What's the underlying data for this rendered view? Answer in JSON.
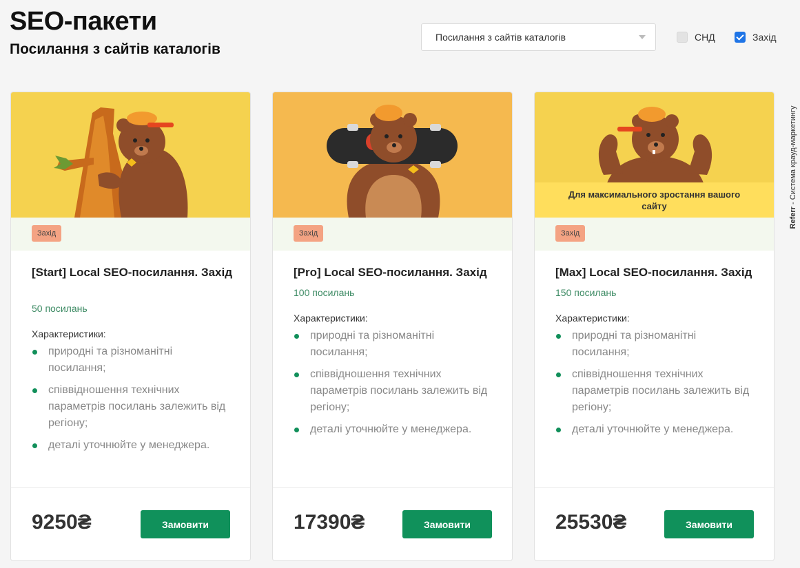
{
  "header": {
    "title": "SEO-пакети",
    "subtitle": "Посилання з сайтів каталогів"
  },
  "filters": {
    "select_value": "Посилання з сайтів каталогів",
    "checkboxes": [
      {
        "label": "СНД",
        "checked": false
      },
      {
        "label": "Захід",
        "checked": true
      }
    ]
  },
  "side_label": {
    "brand": "Referr",
    "text": "- Система крауд-маркетингу"
  },
  "colors": {
    "accent_green": "#10915b",
    "tag_bg": "#f4a383",
    "hero_yellow": "#f5d24f",
    "checkbox_blue": "#1e74e6"
  },
  "cards": [
    {
      "tag": "Захід",
      "title": "[Start] Local SEO-посилання. Захід",
      "count": "50 посилань",
      "chars_heading": "Характеристики:",
      "features": [
        "природні та різноманітні посилання;",
        "співвідношення технічних параметрів посилань залежить від регіону;",
        "деталі уточнюйте у менеджера."
      ],
      "price": "9250₴",
      "button": "Замовити",
      "image": "bear-climbing-tree-illustration"
    },
    {
      "tag": "Захід",
      "title": "[Pro] Local SEO-посилання. Захід",
      "count": "100 посилань",
      "chars_heading": "Характеристики:",
      "features": [
        "природні та різноманітні посилання;",
        "співвідношення технічних параметрів посилань залежить від регіону;",
        "деталі уточнюйте у менеджера."
      ],
      "price": "17390₴",
      "button": "Замовити",
      "image": "bear-with-skateboard-illustration"
    },
    {
      "tag": "Захід",
      "title": "[Max] Local SEO-посилання. Захід",
      "count": "150 посилань",
      "chars_heading": "Характеристики:",
      "features": [
        "природні та різноманітні посилання;",
        "співвідношення технічних параметрів посилань залежить від регіону;",
        "деталі уточнюйте у менеджера."
      ],
      "price": "25530₴",
      "button": "Замовити",
      "image": "bear-flexing-illustration",
      "banner": "Для максимального зростання вашого сайту"
    }
  ]
}
